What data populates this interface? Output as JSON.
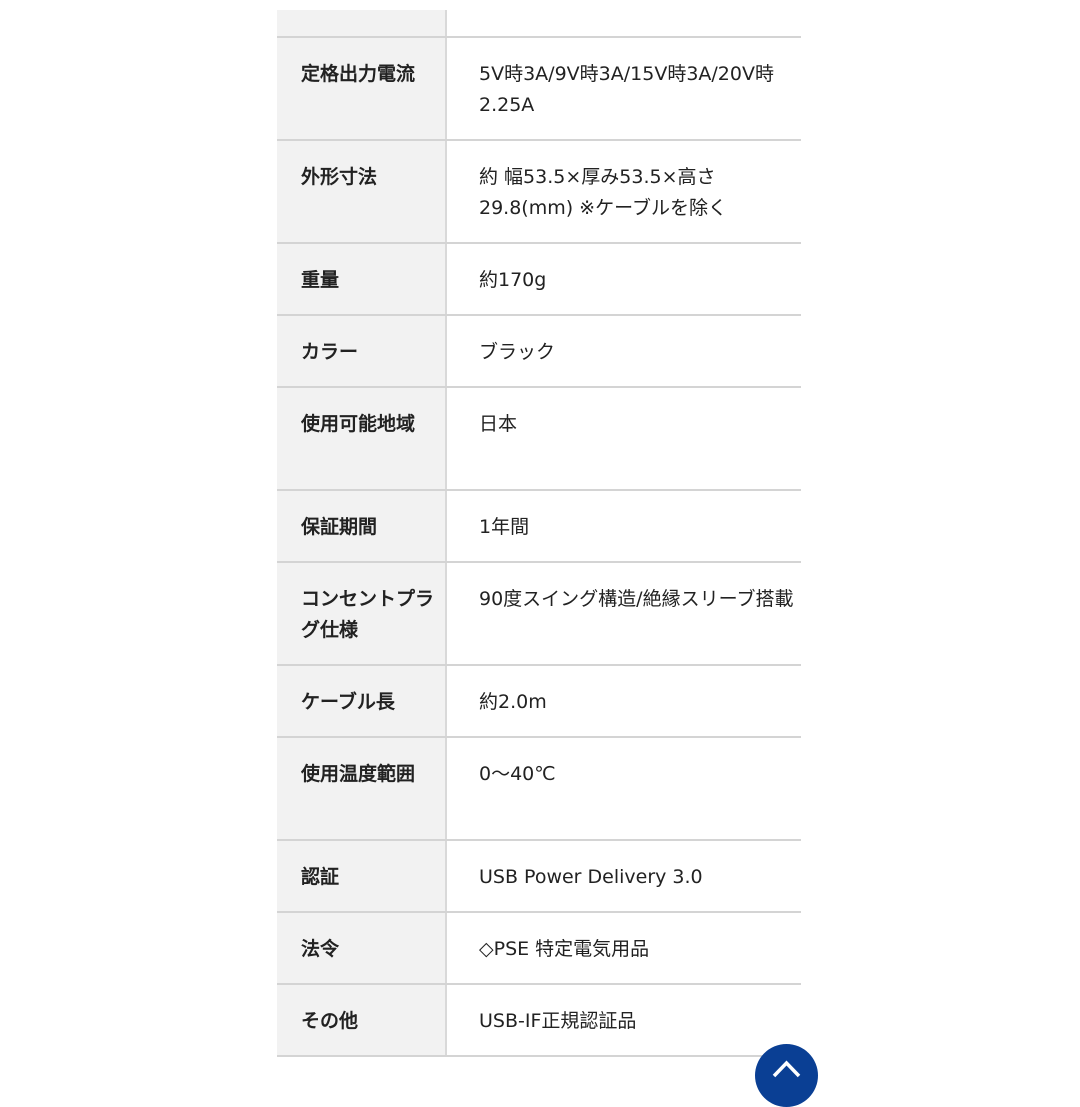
{
  "spec_table": [
    {
      "label": "定格出力電流",
      "value": "5V時3A/9V時3A/15V時3A/20V時2.25A"
    },
    {
      "label": "外形寸法",
      "value": "約 幅53.5×厚み53.5×高さ29.8(mm) ※ケーブルを除く"
    },
    {
      "label": "重量",
      "value": "約170g"
    },
    {
      "label": "カラー",
      "value": "ブラック"
    },
    {
      "label": "使用可能地域",
      "value": "日本"
    },
    {
      "label": "保証期間",
      "value": "1年間"
    },
    {
      "label": "コンセントプラグ仕様",
      "value": "90度スイング構造/絶縁スリーブ搭載"
    },
    {
      "label": "ケーブル長",
      "value": "約2.0m"
    },
    {
      "label": "使用温度範囲",
      "value": "0〜40℃"
    },
    {
      "label": "認証",
      "value": "USB Power Delivery 3.0"
    },
    {
      "label": "法令",
      "value": "◇PSE 特定電気用品"
    },
    {
      "label": "その他",
      "value": "USB-IF正規認証品"
    }
  ],
  "scroll_top_icon": "chevron-up-icon",
  "accent_color": "#0a3f94"
}
